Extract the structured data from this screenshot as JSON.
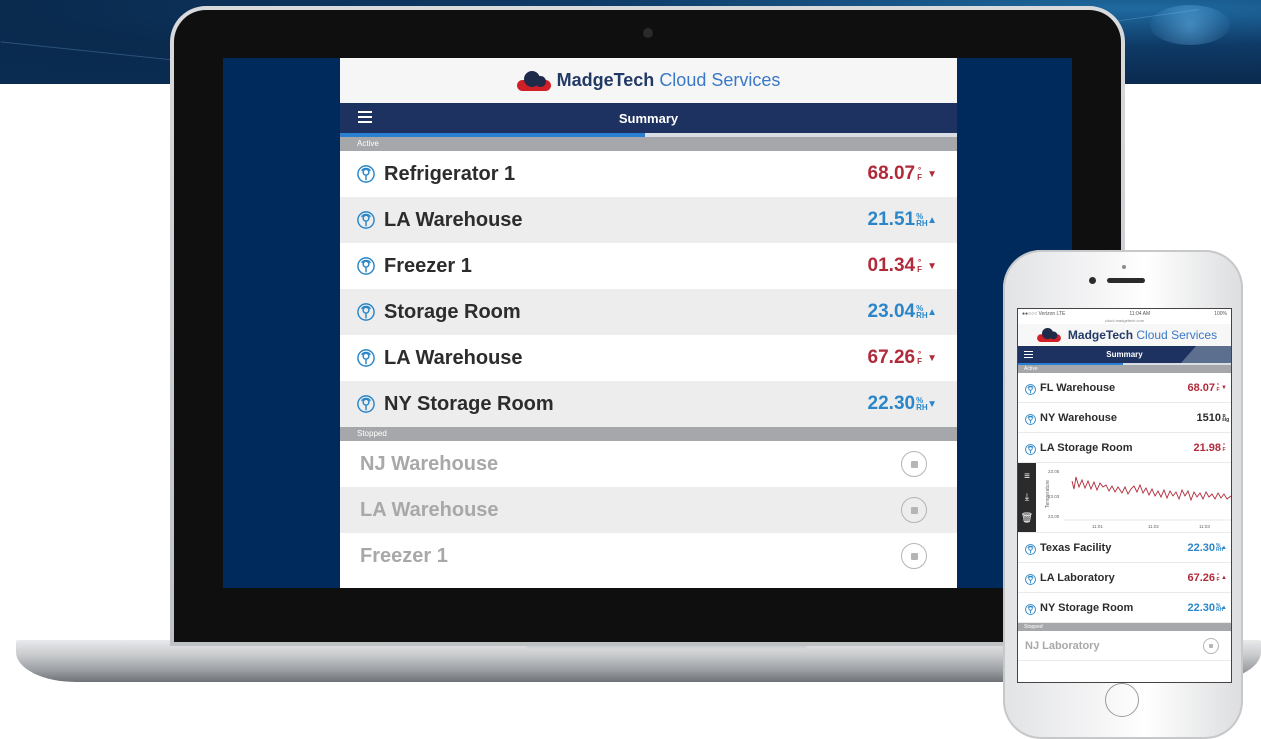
{
  "laptop": {
    "brand": {
      "name_bold": "MadgeTech",
      "name_light": "Cloud Services"
    },
    "nav_title": "Summary",
    "active_label": "Active",
    "stopped_label": "Stopped",
    "active": [
      {
        "name": "Refrigerator 1",
        "value": "68.07",
        "unit_top": "°",
        "unit_bottom": "F",
        "arrow": "▼",
        "color": "red"
      },
      {
        "name": "LA Warehouse",
        "value": "21.51",
        "unit_top": "%",
        "unit_bottom": "RH",
        "arrow": "▲",
        "color": "blue"
      },
      {
        "name": "Freezer 1",
        "value": "01.34",
        "unit_top": "°",
        "unit_bottom": "F",
        "arrow": "▼",
        "color": "red"
      },
      {
        "name": "Storage Room",
        "value": "23.04",
        "unit_top": "%",
        "unit_bottom": "RH",
        "arrow": "▲",
        "color": "blue"
      },
      {
        "name": "LA Warehouse",
        "value": "67.26",
        "unit_top": "°",
        "unit_bottom": "F",
        "arrow": "▼",
        "color": "red"
      },
      {
        "name": "NY Storage Room",
        "value": "22.30",
        "unit_top": "%",
        "unit_bottom": "RH",
        "arrow": "▼",
        "color": "blue"
      }
    ],
    "stopped": [
      {
        "name": "NJ Warehouse"
      },
      {
        "name": "LA Warehouse"
      },
      {
        "name": "Freezer 1"
      }
    ]
  },
  "phone": {
    "carrier": "●●○○○ Verizon  LTE",
    "time": "11:04 AM",
    "battery": "100%",
    "url": "cloud.madgetech.com",
    "brand": {
      "name_bold": "MadgeTech",
      "name_light": "Cloud Services"
    },
    "nav_title": "Summary",
    "active_label": "Active",
    "stopped_label": "Stopped",
    "rows_top": [
      {
        "name": "FL Warehouse",
        "value": "68.07",
        "unit_top": "°",
        "unit_bottom": "F",
        "arrow": "▼",
        "color": "red"
      },
      {
        "name": "NY Warehouse",
        "value": "1510",
        "unit_top": "p",
        "unit_bottom": "sig",
        "arrow": "",
        "color": "dark"
      },
      {
        "name": "LA Storage Room",
        "value": "21.98",
        "unit_top": "°",
        "unit_bottom": "F",
        "arrow": "",
        "color": "red"
      }
    ],
    "chart": {
      "ylabel": "Temperature",
      "y_ticks": [
        "23.05",
        "23.03",
        "23.00"
      ],
      "x_ticks": [
        "11:01",
        "11:02",
        "11:03"
      ]
    },
    "rows_bottom": [
      {
        "name": "Texas Facility",
        "value": "22.30",
        "unit_top": "%",
        "unit_bottom": "RH",
        "arrow": "▲",
        "color": "blue"
      },
      {
        "name": "LA Laboratory",
        "value": "67.26",
        "unit_top": "°",
        "unit_bottom": "F",
        "arrow": "▲",
        "color": "red"
      },
      {
        "name": "NY Storage Room",
        "value": "22.30",
        "unit_top": "%",
        "unit_bottom": "RH",
        "arrow": "▲",
        "color": "blue"
      }
    ],
    "stopped": [
      {
        "name": "NJ Laboratory"
      }
    ]
  },
  "colors": {
    "red": "#b12a3a",
    "blue": "#2a86c8",
    "navy": "#1d3260",
    "progress": "#2a7fd0"
  }
}
